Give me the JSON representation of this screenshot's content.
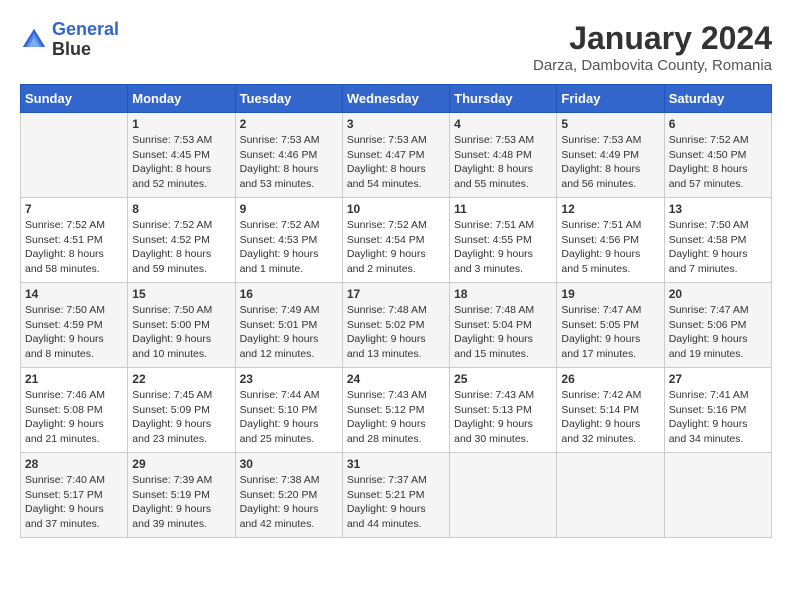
{
  "header": {
    "logo_line1": "General",
    "logo_line2": "Blue",
    "month": "January 2024",
    "location": "Darza, Dambovita County, Romania"
  },
  "columns": [
    "Sunday",
    "Monday",
    "Tuesday",
    "Wednesday",
    "Thursday",
    "Friday",
    "Saturday"
  ],
  "weeks": [
    [
      {
        "day": "",
        "info": ""
      },
      {
        "day": "1",
        "info": "Sunrise: 7:53 AM\nSunset: 4:45 PM\nDaylight: 8 hours\nand 52 minutes."
      },
      {
        "day": "2",
        "info": "Sunrise: 7:53 AM\nSunset: 4:46 PM\nDaylight: 8 hours\nand 53 minutes."
      },
      {
        "day": "3",
        "info": "Sunrise: 7:53 AM\nSunset: 4:47 PM\nDaylight: 8 hours\nand 54 minutes."
      },
      {
        "day": "4",
        "info": "Sunrise: 7:53 AM\nSunset: 4:48 PM\nDaylight: 8 hours\nand 55 minutes."
      },
      {
        "day": "5",
        "info": "Sunrise: 7:53 AM\nSunset: 4:49 PM\nDaylight: 8 hours\nand 56 minutes."
      },
      {
        "day": "6",
        "info": "Sunrise: 7:52 AM\nSunset: 4:50 PM\nDaylight: 8 hours\nand 57 minutes."
      }
    ],
    [
      {
        "day": "7",
        "info": "Sunrise: 7:52 AM\nSunset: 4:51 PM\nDaylight: 8 hours\nand 58 minutes."
      },
      {
        "day": "8",
        "info": "Sunrise: 7:52 AM\nSunset: 4:52 PM\nDaylight: 8 hours\nand 59 minutes."
      },
      {
        "day": "9",
        "info": "Sunrise: 7:52 AM\nSunset: 4:53 PM\nDaylight: 9 hours\nand 1 minute."
      },
      {
        "day": "10",
        "info": "Sunrise: 7:52 AM\nSunset: 4:54 PM\nDaylight: 9 hours\nand 2 minutes."
      },
      {
        "day": "11",
        "info": "Sunrise: 7:51 AM\nSunset: 4:55 PM\nDaylight: 9 hours\nand 3 minutes."
      },
      {
        "day": "12",
        "info": "Sunrise: 7:51 AM\nSunset: 4:56 PM\nDaylight: 9 hours\nand 5 minutes."
      },
      {
        "day": "13",
        "info": "Sunrise: 7:50 AM\nSunset: 4:58 PM\nDaylight: 9 hours\nand 7 minutes."
      }
    ],
    [
      {
        "day": "14",
        "info": "Sunrise: 7:50 AM\nSunset: 4:59 PM\nDaylight: 9 hours\nand 8 minutes."
      },
      {
        "day": "15",
        "info": "Sunrise: 7:50 AM\nSunset: 5:00 PM\nDaylight: 9 hours\nand 10 minutes."
      },
      {
        "day": "16",
        "info": "Sunrise: 7:49 AM\nSunset: 5:01 PM\nDaylight: 9 hours\nand 12 minutes."
      },
      {
        "day": "17",
        "info": "Sunrise: 7:48 AM\nSunset: 5:02 PM\nDaylight: 9 hours\nand 13 minutes."
      },
      {
        "day": "18",
        "info": "Sunrise: 7:48 AM\nSunset: 5:04 PM\nDaylight: 9 hours\nand 15 minutes."
      },
      {
        "day": "19",
        "info": "Sunrise: 7:47 AM\nSunset: 5:05 PM\nDaylight: 9 hours\nand 17 minutes."
      },
      {
        "day": "20",
        "info": "Sunrise: 7:47 AM\nSunset: 5:06 PM\nDaylight: 9 hours\nand 19 minutes."
      }
    ],
    [
      {
        "day": "21",
        "info": "Sunrise: 7:46 AM\nSunset: 5:08 PM\nDaylight: 9 hours\nand 21 minutes."
      },
      {
        "day": "22",
        "info": "Sunrise: 7:45 AM\nSunset: 5:09 PM\nDaylight: 9 hours\nand 23 minutes."
      },
      {
        "day": "23",
        "info": "Sunrise: 7:44 AM\nSunset: 5:10 PM\nDaylight: 9 hours\nand 25 minutes."
      },
      {
        "day": "24",
        "info": "Sunrise: 7:43 AM\nSunset: 5:12 PM\nDaylight: 9 hours\nand 28 minutes."
      },
      {
        "day": "25",
        "info": "Sunrise: 7:43 AM\nSunset: 5:13 PM\nDaylight: 9 hours\nand 30 minutes."
      },
      {
        "day": "26",
        "info": "Sunrise: 7:42 AM\nSunset: 5:14 PM\nDaylight: 9 hours\nand 32 minutes."
      },
      {
        "day": "27",
        "info": "Sunrise: 7:41 AM\nSunset: 5:16 PM\nDaylight: 9 hours\nand 34 minutes."
      }
    ],
    [
      {
        "day": "28",
        "info": "Sunrise: 7:40 AM\nSunset: 5:17 PM\nDaylight: 9 hours\nand 37 minutes."
      },
      {
        "day": "29",
        "info": "Sunrise: 7:39 AM\nSunset: 5:19 PM\nDaylight: 9 hours\nand 39 minutes."
      },
      {
        "day": "30",
        "info": "Sunrise: 7:38 AM\nSunset: 5:20 PM\nDaylight: 9 hours\nand 42 minutes."
      },
      {
        "day": "31",
        "info": "Sunrise: 7:37 AM\nSunset: 5:21 PM\nDaylight: 9 hours\nand 44 minutes."
      },
      {
        "day": "",
        "info": ""
      },
      {
        "day": "",
        "info": ""
      },
      {
        "day": "",
        "info": ""
      }
    ]
  ]
}
